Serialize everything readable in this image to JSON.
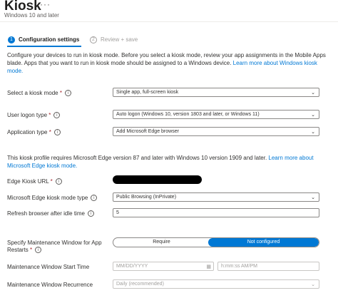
{
  "header": {
    "title": "Kiosk",
    "more": "···",
    "subtitle": "Windows 10 and later"
  },
  "steps": [
    {
      "number": "1",
      "label": "Configuration settings"
    },
    {
      "number": "2",
      "label": "Review + save"
    }
  ],
  "intro": {
    "text": "Configure your devices to run in kiosk mode. Before you select a kiosk mode, review your app assignments in the Mobile Apps blade. Apps that you want to run in kiosk mode should be assigned to a Windows device. ",
    "link": "Learn more about Windows kiosk mode."
  },
  "fields": {
    "kiosk_mode": {
      "label": "Select a kiosk mode",
      "required": "*",
      "value": "Single app, full-screen kiosk"
    },
    "user_logon": {
      "label": "User logon type",
      "required": "*",
      "value": "Auto logon (Windows 10, version 1803 and later, or Windows 11)"
    },
    "app_type": {
      "label": "Application type",
      "required": "*",
      "value": "Add Microsoft Edge browser"
    }
  },
  "edge_note": {
    "text": "This kiosk profile requires Microsoft Edge version 87 and later with Windows 10 version 1909 and later. ",
    "link": "Learn more about Microsoft Edge kiosk mode."
  },
  "edge": {
    "url": {
      "label": "Edge Kiosk URL",
      "required": "*"
    },
    "mode": {
      "label": "Microsoft Edge kiosk mode type",
      "value": "Public Browsing (InPrivate)"
    },
    "refresh": {
      "label": "Refresh browser after idle time",
      "value": "5"
    }
  },
  "maintenance": {
    "window_label_1": "Specify Maintenance Window for App",
    "window_label_2": "Restarts",
    "required": "*",
    "toggle_options": [
      "Require",
      "Not configured"
    ],
    "start_label": "Maintenance Window Start Time",
    "date_placeholder": "MM/DD/YYYY",
    "time_placeholder": "h:mm:ss AM/PM",
    "recurrence_label": "Maintenance Window Recurrence",
    "recurrence_value": "Daily (recommended)"
  },
  "icons": {
    "info": "info-icon",
    "chevron": "chevron-down-icon",
    "calendar": "calendar-icon"
  },
  "colors": {
    "accent": "#0078d4",
    "required": "#a4262c"
  }
}
